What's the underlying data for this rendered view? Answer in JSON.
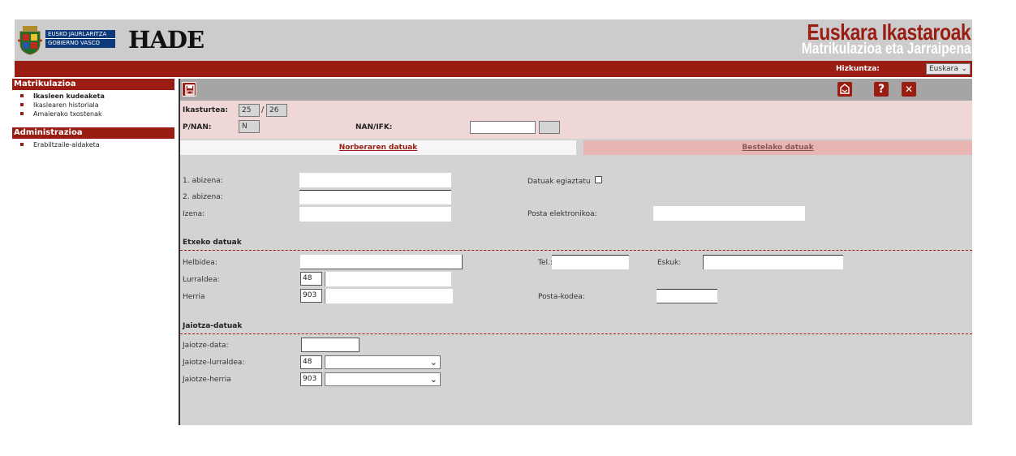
{
  "header": {
    "gov_line1": "EUSKO JAURLARITZA",
    "gov_line2": "GOBIERNO VASCO",
    "app_name": "HADE",
    "brand_title": "Euskara Ikastaroak",
    "brand_subtitle": "Matrikulazioa eta Jarraipena"
  },
  "language": {
    "label": "Hizkuntza:",
    "selected": "Euskara"
  },
  "sidebar": {
    "sections": [
      {
        "title": "Matrikulazioa",
        "items": [
          "Ikasleen kudeaketa",
          "Ikaslearen historiala",
          "Amaierako txostenak"
        ]
      },
      {
        "title": "Administrazioa",
        "items": [
          "Erabiltzaile-aldaketa"
        ]
      }
    ]
  },
  "toolbar": {
    "help_glyph": "?",
    "close_glyph": "✕"
  },
  "filters": {
    "course_label": "Ikasturtea:",
    "course_from": "25",
    "separator": "/",
    "course_to": "26",
    "pnan_label": "P/NAN:",
    "pnan_value": "N",
    "nan_label": "NAN/IFK:"
  },
  "tabs": {
    "active": "Norberaren datuak",
    "inactive": "Bestelako datuak"
  },
  "personal": {
    "surname1_label": "1. abizena:",
    "surname2_label": "2. abizena:",
    "name_label": "Izena:",
    "verify_label": "Datuak egiaztatu",
    "email_label": "Posta elektronikoa:"
  },
  "home": {
    "section_title": "Etxeko datuak",
    "address_label": "Helbidea:",
    "phone_label": "Tel.:",
    "mobile_label": "Eskuk:",
    "province_label": "Lurraldea:",
    "province_code": "48",
    "town_label": "Herria",
    "town_code": "903",
    "postcode_label": "Posta-kodea:"
  },
  "birth": {
    "section_title": "Jaiotza-datuak",
    "date_label": "Jaiotze-data:",
    "province_label": "Jaiotze-lurraldea:",
    "province_code": "48",
    "town_label": "Jaiotze-herria",
    "town_code": "903"
  },
  "colors": {
    "accent": "#9a1d14",
    "header_bg": "#cccccc",
    "panel_bg": "#efd7d7",
    "form_bg": "#d3d3d3"
  }
}
